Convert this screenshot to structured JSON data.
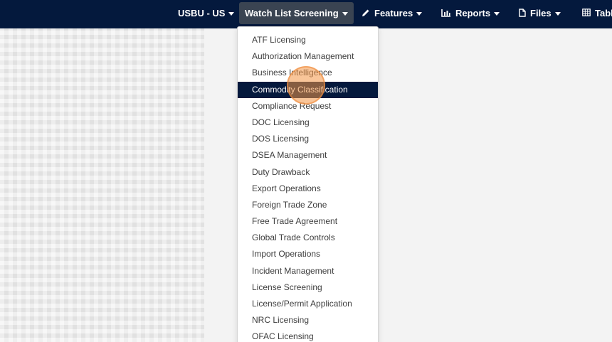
{
  "nav": {
    "business_unit": "USBU - US",
    "watch_list": "Watch List Screening",
    "features": "Features",
    "reports": "Reports",
    "files": "Files",
    "tables": "Tabl"
  },
  "icons": {
    "features": "pencil-icon",
    "reports": "bar-chart-icon",
    "files": "file-icon",
    "tables": "table-icon"
  },
  "colors": {
    "topbar": "#04193d",
    "active_nav": "#3a4452",
    "highlight_row": "#04193d",
    "cursor_marker": "#f4964a"
  },
  "dropdown": {
    "highlighted_index": 3,
    "items": [
      "ATF Licensing",
      "Authorization Management",
      "Business Intelligence",
      "Commodity Classification",
      "Compliance Request",
      "DOC Licensing",
      "DOS Licensing",
      "DSEA Management",
      "Duty Drawback",
      "Export Operations",
      "Foreign Trade Zone",
      "Free Trade Agreement",
      "Global Trade Controls",
      "Import Operations",
      "Incident Management",
      "License Screening",
      "License/Permit Application",
      "NRC Licensing",
      "OFAC Licensing"
    ]
  }
}
